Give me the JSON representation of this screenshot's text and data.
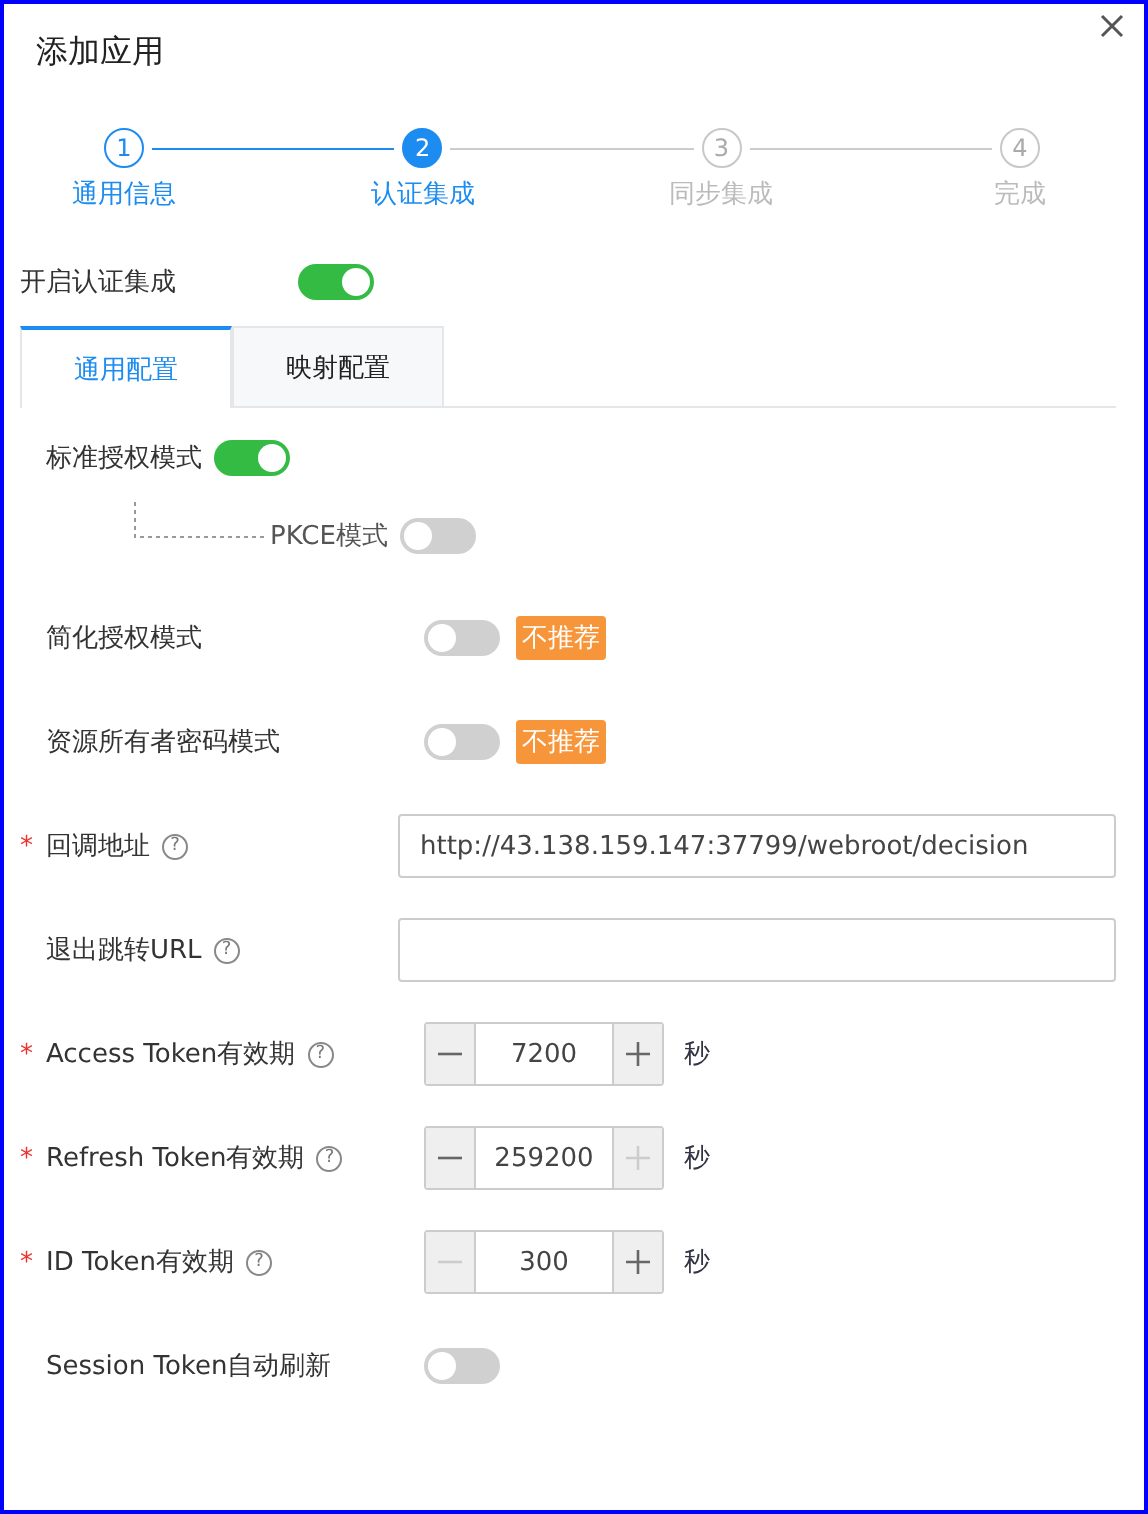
{
  "dialog": {
    "title": "添加应用"
  },
  "steps": [
    {
      "number": "1",
      "label": "通用信息",
      "completed": true,
      "selected": false
    },
    {
      "number": "2",
      "label": "认证集成",
      "completed": false,
      "selected": true
    },
    {
      "number": "3",
      "label": "同步集成",
      "completed": false,
      "selected": false
    },
    {
      "number": "4",
      "label": "完成",
      "completed": false,
      "selected": false
    }
  ],
  "enable": {
    "label": "开启认证集成",
    "on": true
  },
  "tabs": [
    {
      "label": "通用配置",
      "selected": true
    },
    {
      "label": "映射配置",
      "selected": false
    }
  ],
  "fields": [
    {
      "kind": "switch",
      "label": "标准授权模式",
      "on": true,
      "children": [
        {
          "label": "PKCE模式",
          "on": false
        }
      ]
    },
    {
      "kind": "switch",
      "label": "简化授权模式",
      "on": false,
      "badge": "不推荐"
    },
    {
      "kind": "switch",
      "label": "资源所有者密码模式",
      "on": false,
      "badge": "不推荐"
    },
    {
      "kind": "text",
      "mark": "*",
      "label": "回调地址",
      "help": "?",
      "value": "http://43.138.159.147:37799/webroot/decision"
    },
    {
      "kind": "text",
      "label": "退出跳转URL",
      "help": "?"
    },
    {
      "kind": "number",
      "mark": "*",
      "label": "Access Token有效期",
      "help": "?",
      "value": "7200",
      "unit": "秒",
      "minus_disabled": false,
      "plus_disabled": false
    },
    {
      "kind": "number",
      "mark": "*",
      "label": "Refresh Token有效期",
      "help": "?",
      "value": "259200",
      "unit": "秒",
      "minus_disabled": false,
      "plus_disabled": true
    },
    {
      "kind": "number",
      "mark": "*",
      "label": "ID Token有效期",
      "help": "?",
      "value": "300",
      "unit": "秒",
      "minus_disabled": true,
      "plus_disabled": false
    },
    {
      "kind": "switch",
      "label": "Session Token自动刷新",
      "on": false
    }
  ]
}
